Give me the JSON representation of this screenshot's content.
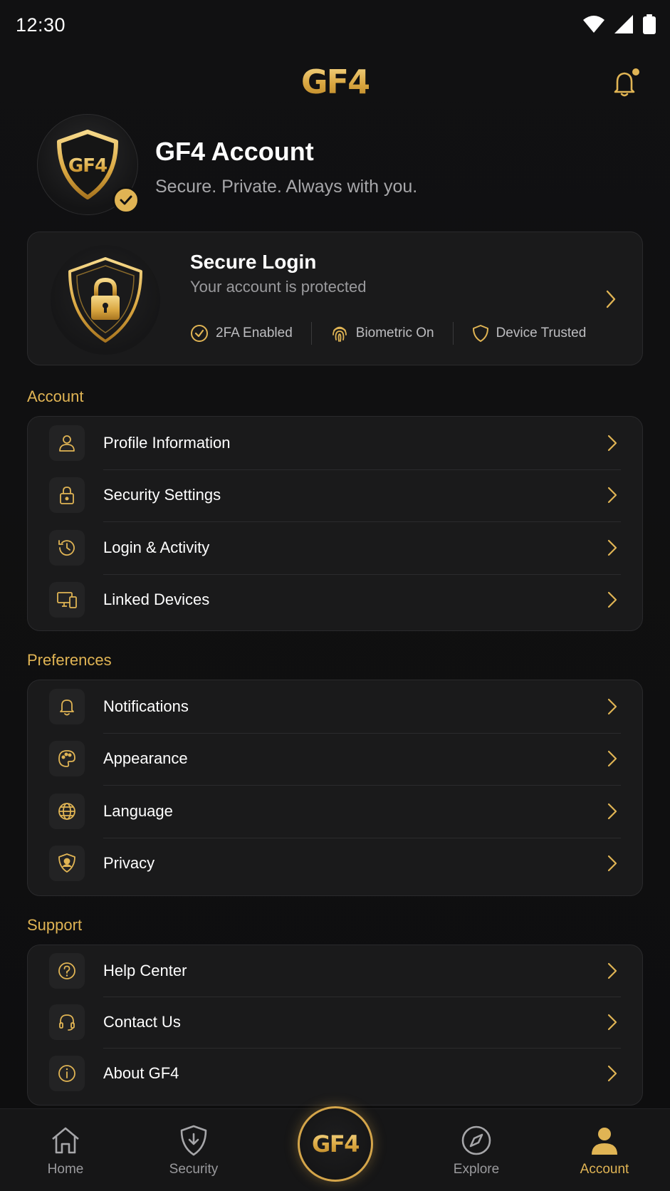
{
  "status_bar": {
    "time": "12:30"
  },
  "header": {
    "logo": "GF4"
  },
  "account": {
    "avatar_logo": "GF4",
    "title": "GF4 Account",
    "subtitle": "Secure. Private. Always with you."
  },
  "secure_login": {
    "title": "Secure Login",
    "subtitle": "Your account is protected",
    "badges": [
      "2FA Enabled",
      "Biometric On",
      "Device Trusted"
    ]
  },
  "sections": {
    "account": {
      "label": "Account",
      "items": [
        "Profile Information",
        "Security Settings",
        "Login & Activity",
        "Linked Devices"
      ]
    },
    "preferences": {
      "label": "Preferences",
      "items": [
        "Notifications",
        "Appearance",
        "Language",
        "Privacy"
      ]
    },
    "support": {
      "label": "Support",
      "items": [
        "Help Center",
        "Contact Us",
        "About GF4"
      ]
    }
  },
  "bottom_nav": {
    "items": [
      "Home",
      "Security",
      "Explore",
      "Account"
    ],
    "center": "GF4",
    "active": "Account"
  },
  "colors": {
    "accent": "#e0b454",
    "background": "#0f0f10",
    "card": "#1a1a1b"
  }
}
